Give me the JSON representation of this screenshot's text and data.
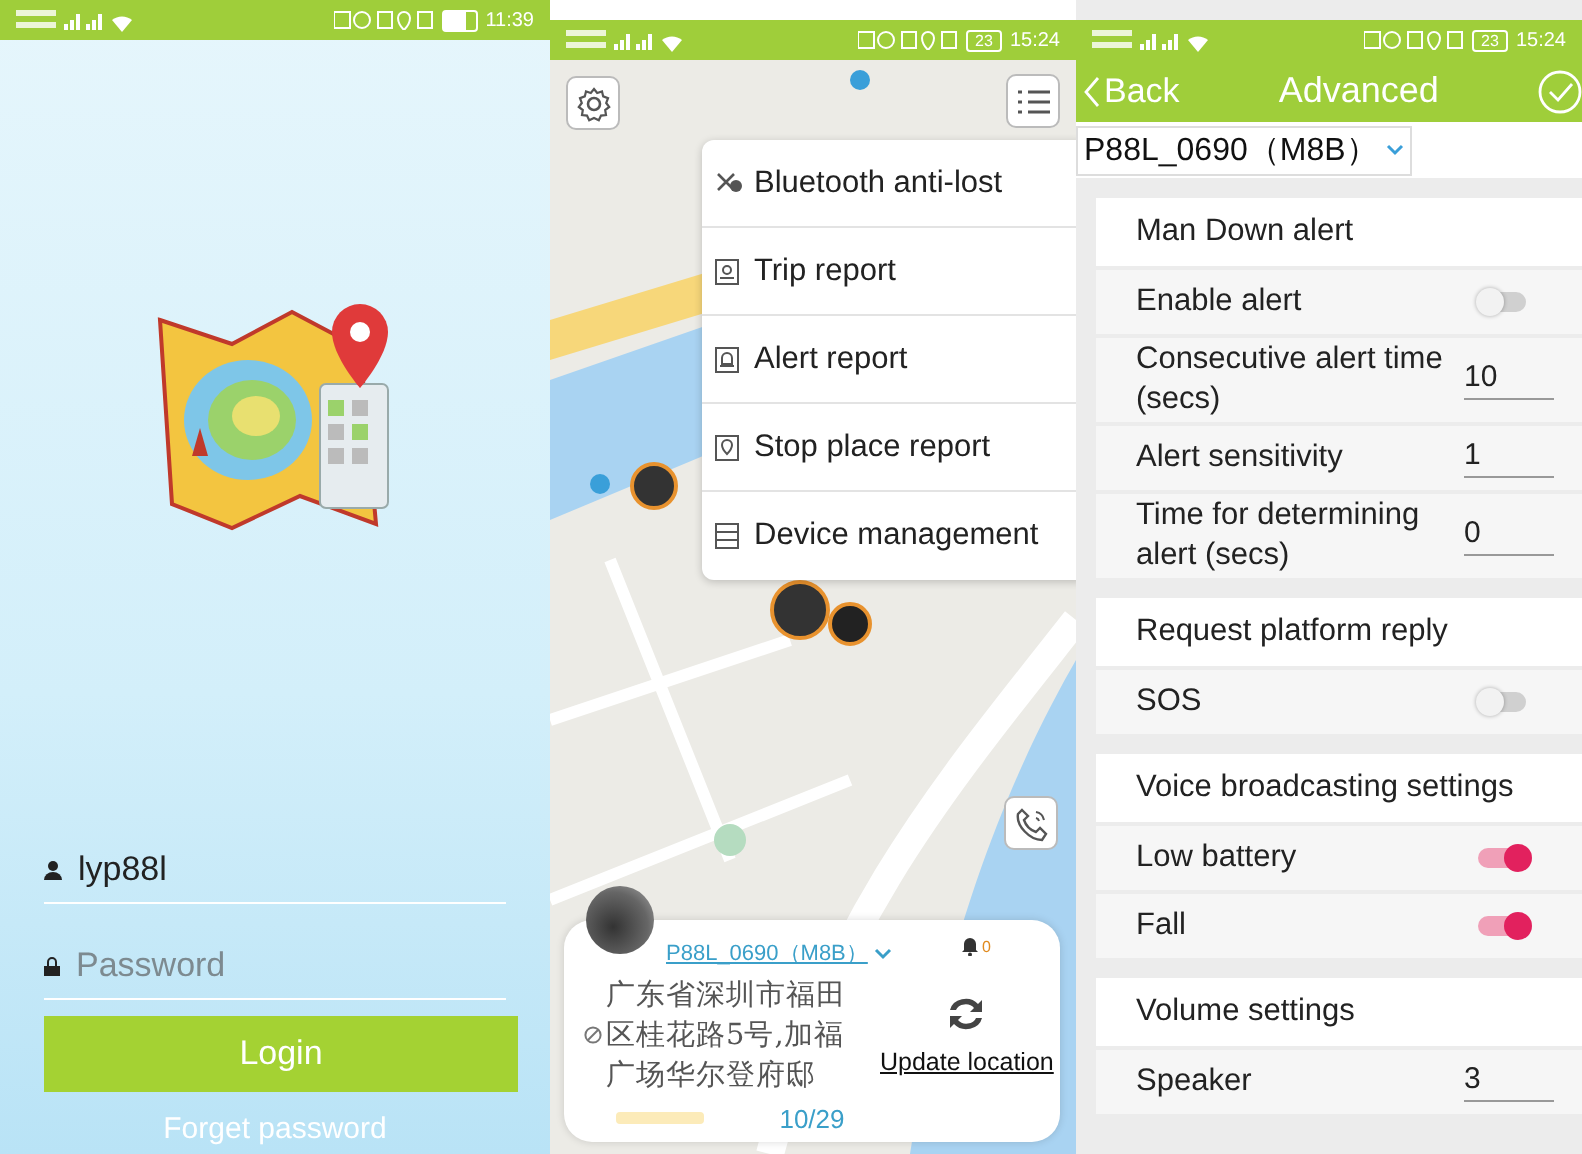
{
  "status_bars": [
    {
      "time": "11:39"
    },
    {
      "time": "15:24",
      "battery": "23"
    },
    {
      "time": "15:24",
      "battery": "23"
    }
  ],
  "login": {
    "username": "lyp88l",
    "password_placeholder": "Password",
    "login_button": "Login",
    "forget_link": "Forget password"
  },
  "map_screen": {
    "menu": [
      {
        "label": "Bluetooth anti-lost"
      },
      {
        "label": "Trip report"
      },
      {
        "label": "Alert report"
      },
      {
        "label": "Stop place report"
      },
      {
        "label": "Device management"
      }
    ],
    "device": {
      "name": "P88L_0690（M8B）",
      "alarm_count": "0",
      "address": "广东省深圳市福田区桂花路5号,加福广场华尔登府邸",
      "update_label": "Update location",
      "page": "10/29"
    }
  },
  "settings": {
    "back": "Back",
    "title": "Advanced",
    "device_select": "P88L_0690（M8B）",
    "groups": [
      {
        "title": "Man Down alert",
        "rows": [
          {
            "kind": "toggle",
            "label": "Enable alert",
            "on": false
          },
          {
            "kind": "input",
            "label": "Consecutive alert time (secs)",
            "value": "10"
          },
          {
            "kind": "input",
            "label": "Alert sensitivity",
            "value": "1"
          },
          {
            "kind": "input",
            "label": "Time for determining alert (secs)",
            "value": "0"
          }
        ]
      },
      {
        "title": "Request platform reply",
        "rows": [
          {
            "kind": "toggle",
            "label": "SOS",
            "on": false
          }
        ]
      },
      {
        "title": "Voice broadcasting settings",
        "rows": [
          {
            "kind": "toggle",
            "label": "Low battery",
            "on": true
          },
          {
            "kind": "toggle",
            "label": "Fall",
            "on": true
          }
        ]
      },
      {
        "title": "Volume settings",
        "rows": [
          {
            "kind": "input",
            "label": "Speaker",
            "value": "3"
          }
        ]
      }
    ]
  }
}
